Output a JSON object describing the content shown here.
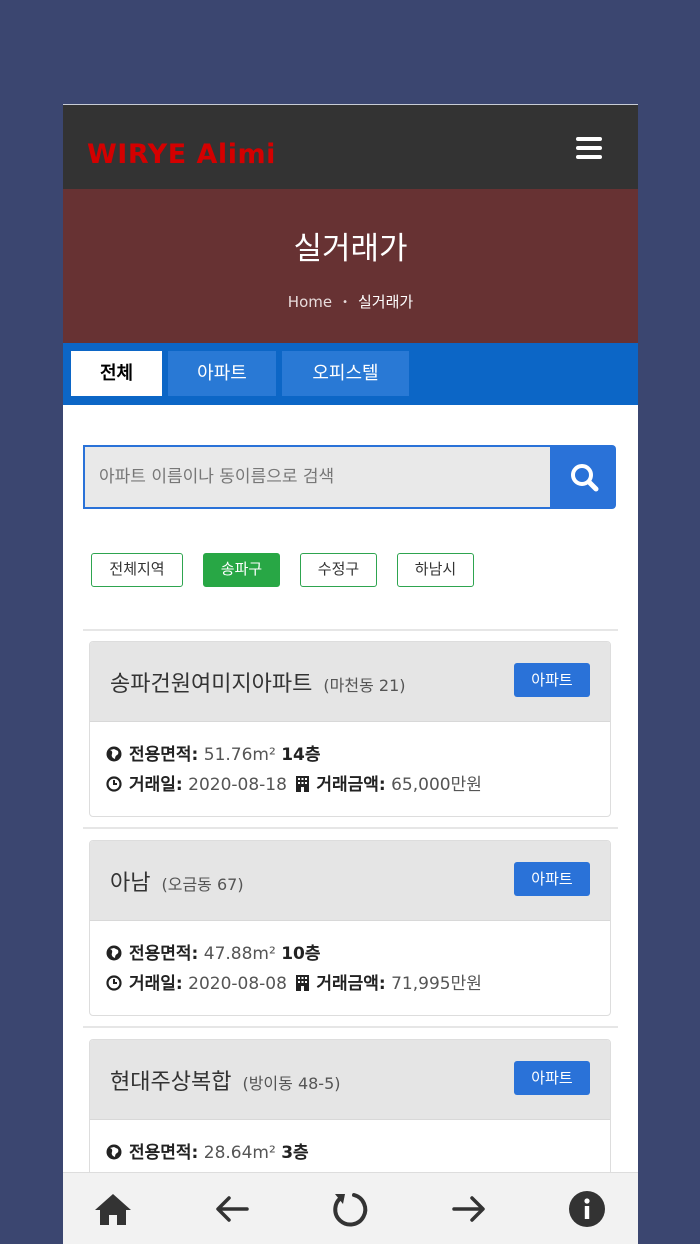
{
  "app": {
    "brand": "WIRYE Alimi"
  },
  "hero": {
    "title": "실거래가",
    "crumb_home": "Home",
    "crumb_sep": "•",
    "crumb_current": "실거래가"
  },
  "tabs": [
    {
      "label": "전체"
    },
    {
      "label": "아파트"
    },
    {
      "label": "오피스텔"
    }
  ],
  "search": {
    "placeholder": "아파트 이름이나 동이름으로 검색"
  },
  "regions": [
    {
      "label": "전체지역"
    },
    {
      "label": "송파구"
    },
    {
      "label": "수정구"
    },
    {
      "label": "하남시"
    }
  ],
  "labels": {
    "area": "전용면적:",
    "date": "거래일:",
    "price": "거래금액:"
  },
  "listings": [
    {
      "name": "송파건원여미지아파트",
      "address": "(마천동 21)",
      "type": "아파트",
      "area": "51.76m²",
      "floor": "14층",
      "date": "2020-08-18",
      "price": "65,000만원"
    },
    {
      "name": "아남",
      "address": "(오금동 67)",
      "type": "아파트",
      "area": "47.88m²",
      "floor": "10층",
      "date": "2020-08-08",
      "price": "71,995만원"
    },
    {
      "name": "현대주상복합",
      "address": "(방이동 48-5)",
      "type": "아파트",
      "area": "28.64m²",
      "floor": "3층",
      "date": "",
      "price": ""
    }
  ],
  "colors": {
    "topbar": "#333333",
    "brand": "#d40000",
    "hero": "#673233",
    "tabs": "#0c66c6",
    "accent": "#2a72d8",
    "chip": "#28a745",
    "background": "#3b4670"
  }
}
